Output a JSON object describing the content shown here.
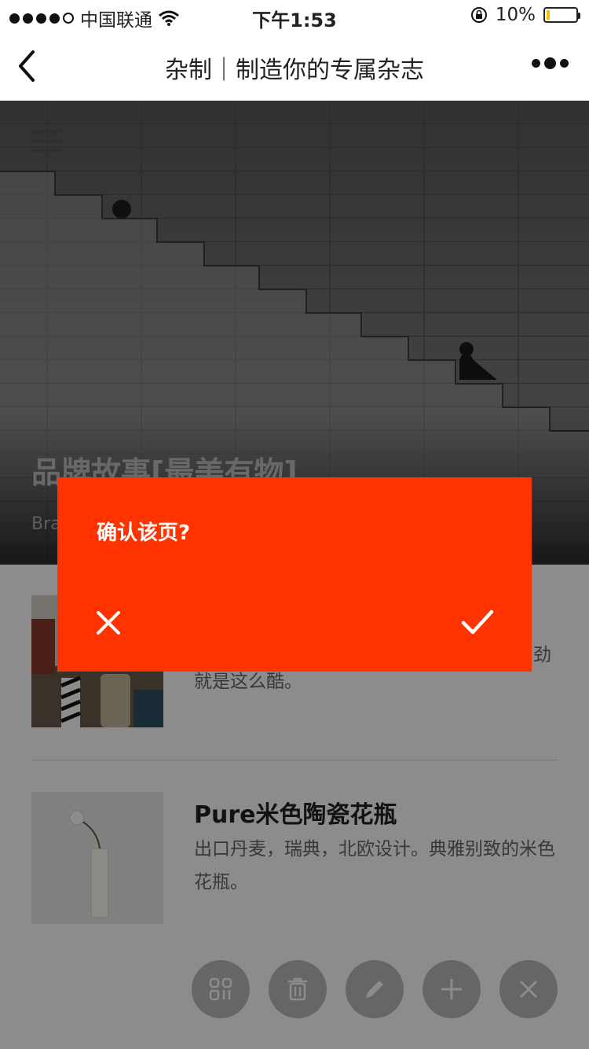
{
  "status_bar": {
    "carrier": "中国联通",
    "time": "下午1:53",
    "battery": "10%",
    "battery_level": 0.1
  },
  "nav": {
    "title": "杂制｜制造你的专属杂志"
  },
  "hero": {
    "heading": "品牌故事[最美有物]",
    "subtitle": "Bra"
  },
  "products": [
    {
      "name": "",
      "description_partial_1": "劲",
      "description_partial_2": "就是这么酷。"
    },
    {
      "name": "Pure米色陶瓷花瓶",
      "description": "出口丹麦，瑞典，北欧设计。典雅别致的米色花瓶。"
    }
  ],
  "toolbar": {
    "buttons": [
      "layout-icon",
      "trash-icon",
      "pencil-icon",
      "plus-icon",
      "close-icon"
    ]
  },
  "dialog": {
    "message": "确认该页?",
    "accent_color": "#ff3300"
  }
}
